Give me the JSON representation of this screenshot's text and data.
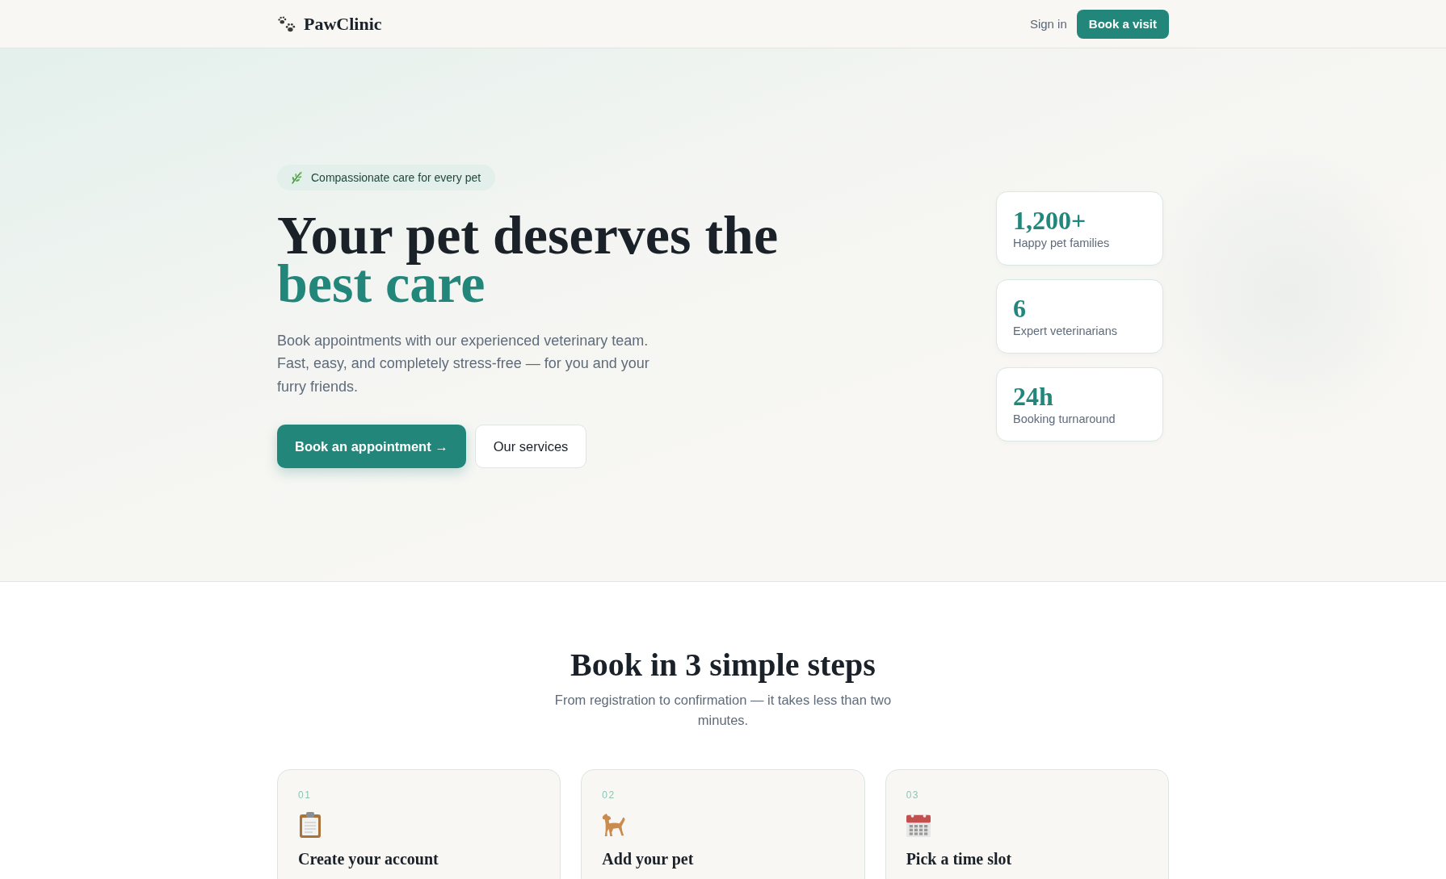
{
  "header": {
    "logo": "PawClinic",
    "sign_in": "Sign in",
    "cta": "Book a visit"
  },
  "hero": {
    "badge": "Compassionate care for every pet",
    "headline": "Your pet deserves the",
    "headline_accent": "best care",
    "description": "Book appointments with our experienced veterinary team. Fast, easy, and completely stress-free — for you and your furry friends.",
    "buttons": [
      {
        "label": "Book an appointment →",
        "kind": "primary"
      },
      {
        "label": "Our services",
        "kind": "secondary"
      }
    ],
    "stats": [
      {
        "value": "1,200+",
        "label": "Happy pet families"
      },
      {
        "value": "6",
        "label": "Expert veterinarians"
      },
      {
        "value": "24h",
        "label": "Booking turnaround"
      }
    ]
  },
  "steps_section": {
    "title": "Book in 3 simple steps",
    "subtitle": "From registration to confirmation — it takes less than two minutes.",
    "steps": [
      {
        "number": "01",
        "title": "Create your account"
      },
      {
        "number": "02",
        "title": "Add your pet"
      },
      {
        "number": "03",
        "title": "Pick a time slot"
      }
    ]
  }
}
